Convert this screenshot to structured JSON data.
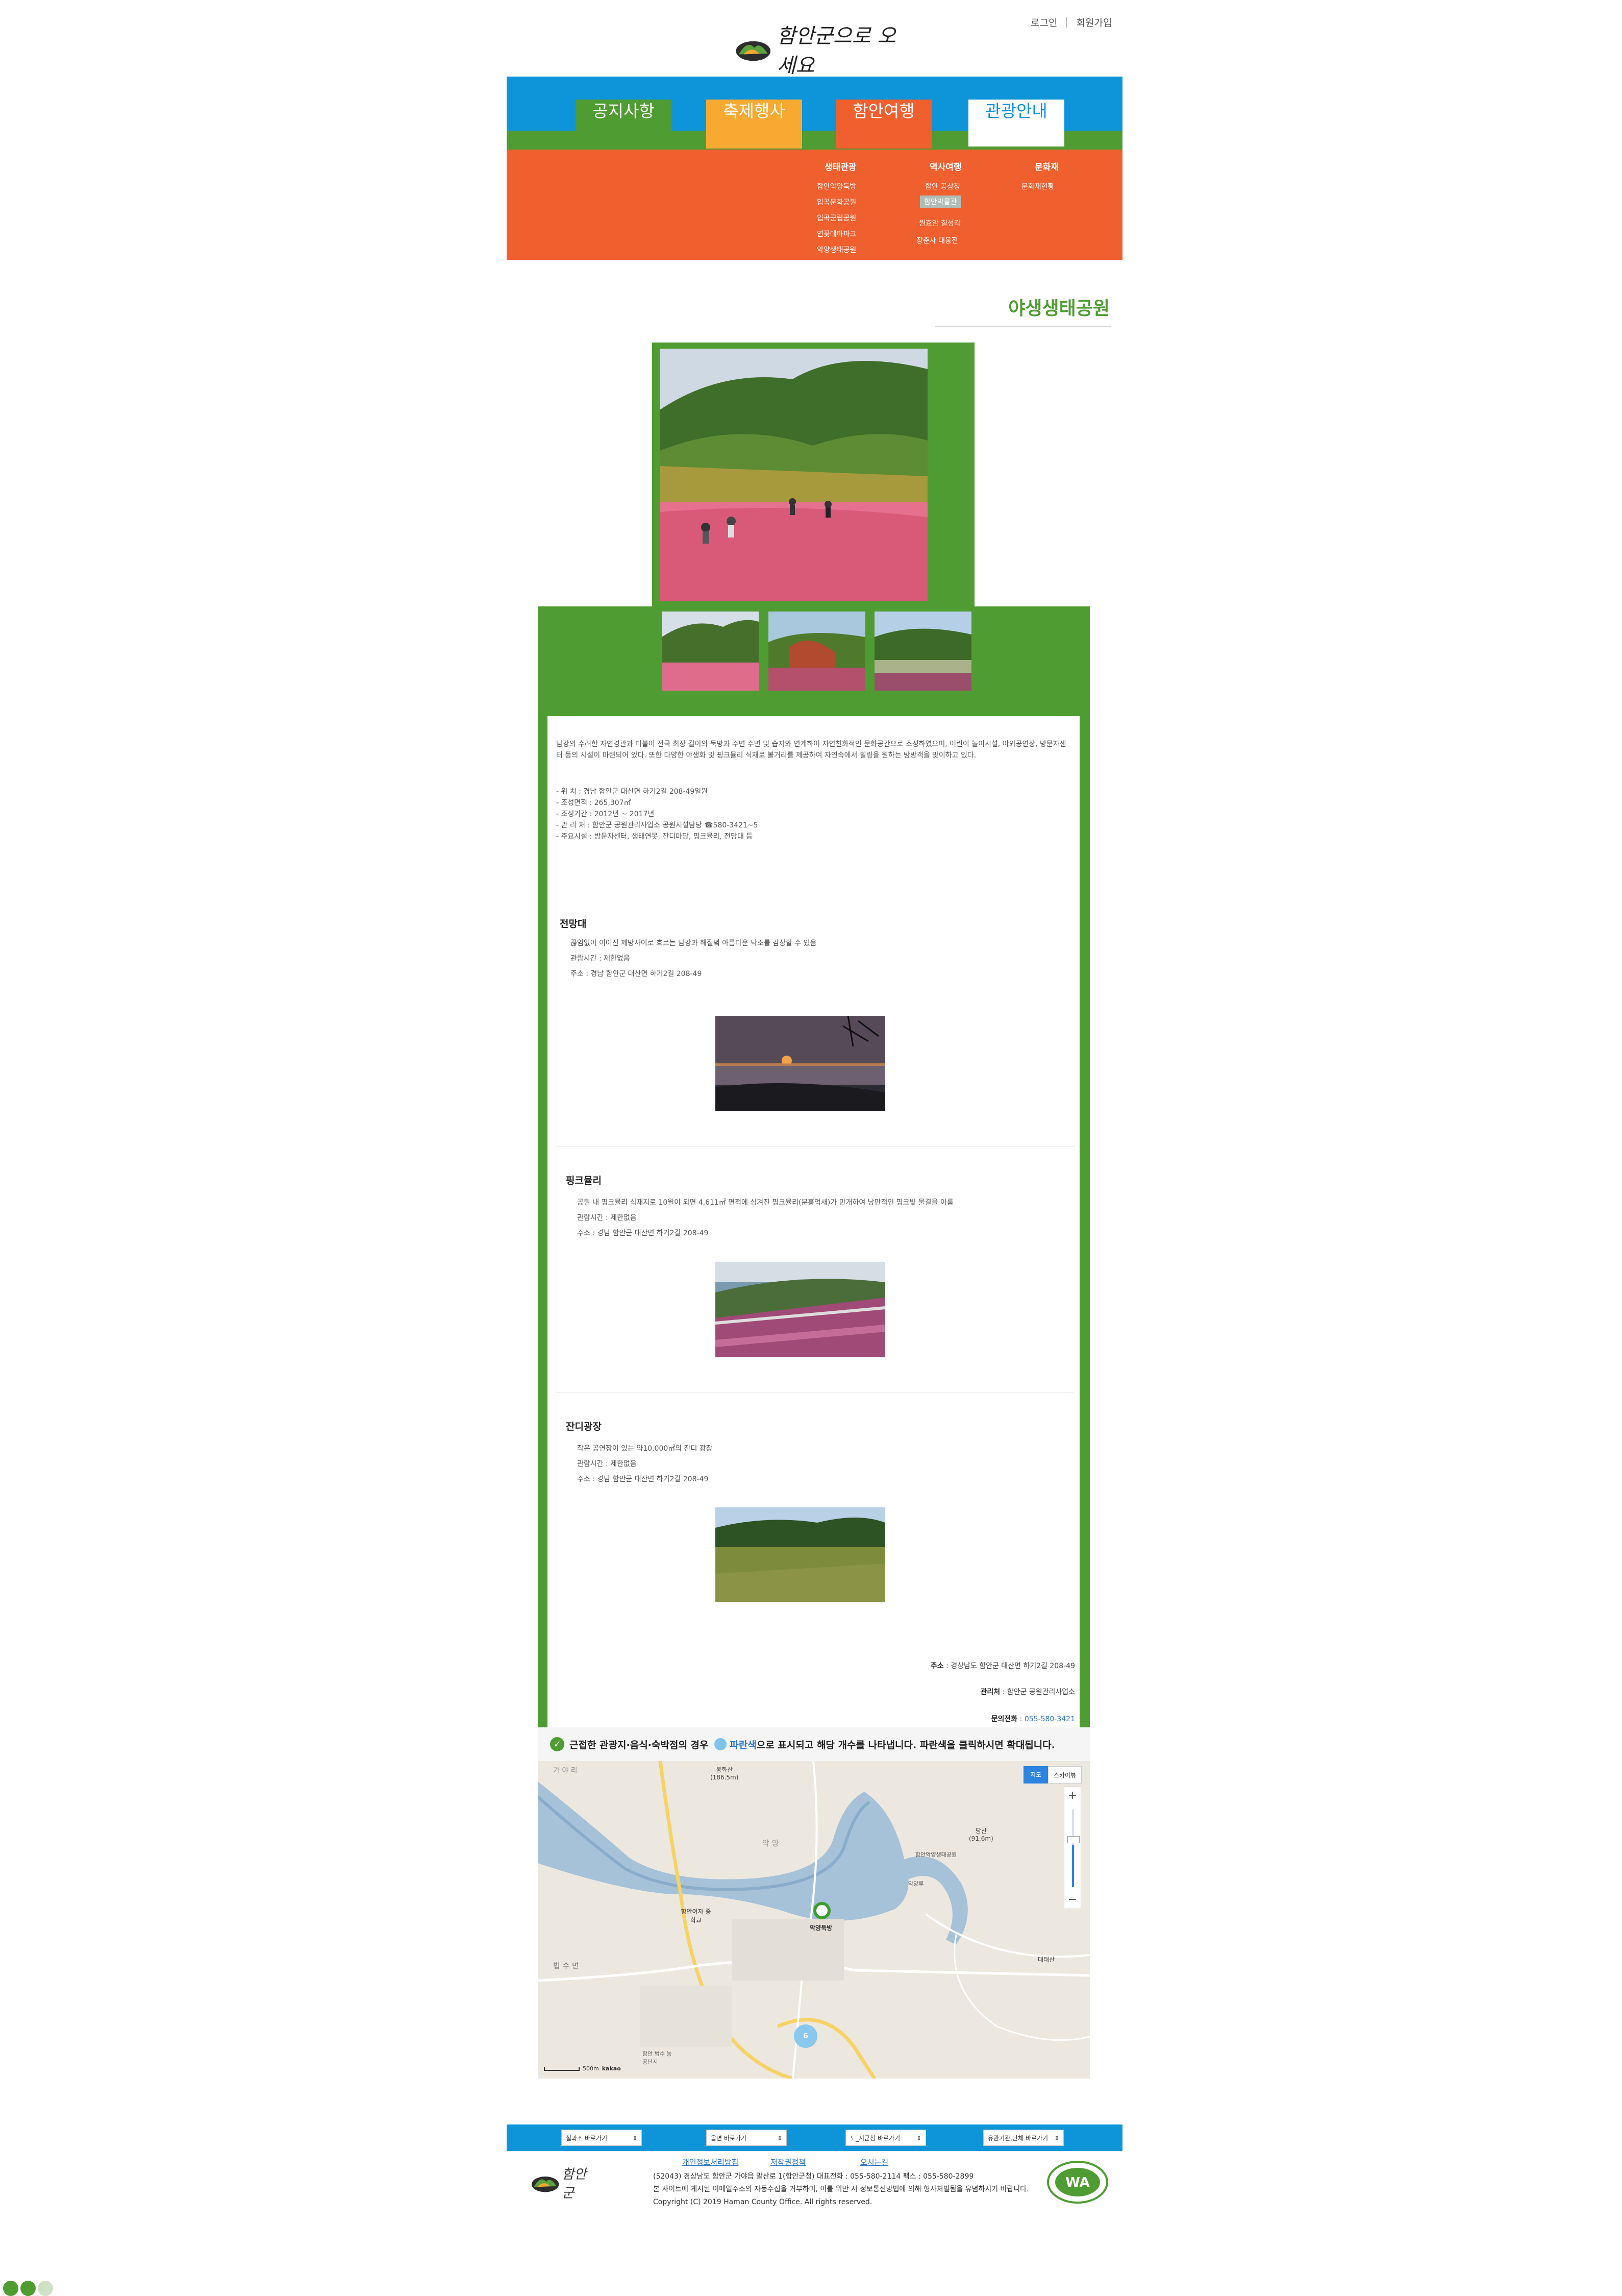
{
  "header": {
    "login": "로그인",
    "signup": "회원가입",
    "logo_text": "함안군으로 오세요"
  },
  "nav": {
    "tabs": [
      {
        "label": "공지사항",
        "color": "#4f9c33"
      },
      {
        "label": "축제행사",
        "color": "#f7a932"
      },
      {
        "label": "함안여행",
        "color": "#f05f2e"
      },
      {
        "label": "관광안내",
        "color": "#ffffff"
      }
    ],
    "submenu": {
      "col1": {
        "title": "생태관광",
        "items": [
          "함안악양둑방",
          "입곡문화공원",
          "입곡군립공원",
          "연꽃테마파크",
          "악양생태공원"
        ]
      },
      "col2": {
        "title": "역사여행",
        "items": [
          "함안 공상청",
          "함안박물관",
          "원효암 칠성각",
          "장춘사 대웅전"
        ]
      },
      "col3": {
        "title": "문화재",
        "items": [
          "문화재현황"
        ]
      }
    }
  },
  "page": {
    "title": "야생생태공원"
  },
  "intro": {
    "text": "남강의 수려한 자연경관과 더불어 전국 최장 길이의 둑방과 주변 수변 및 습지와 연계하여 자연친화적인 문화공간으로 조성하였으며, 어린이 놀이시설, 야외공연장, 방문자센터 등의 시설이 마련되어 있다. 또한 다양한 야생화 및 핑크뮬리 식재로 볼거리를 제공하여 자연속에서 힐링을 원하는 방방객을 맞이하고 있다.",
    "specs": [
      "- 위 치 : 경남 함안군 대산면 하기2길 208-49일원",
      "- 조성면적 : 265,307㎡",
      "- 조성기간 : 2012년 ~ 2017년",
      "- 관 리 처 : 함안군 공원관리사업소 공원시설담당 ☎580-3421~5",
      "- 주요시설 : 방문자센터, 생태연못, 잔디마당, 핑크뮬리, 전망대 등"
    ]
  },
  "sections": [
    {
      "title": "전망대",
      "lines": [
        "끊임없이 이어진 제방사이로 흐르는 남강과 해질녘 아름다운 낙조를 감상할 수 있음",
        "관람시간 : 제한없음",
        "주소 : 경남 함안군 대산면 하기2길 208-49"
      ]
    },
    {
      "title": "핑크뮬리",
      "lines": [
        "공원 내 핑크뮬리 식재지로 10월이 되면 4,611㎡ 면적에 심겨진 핑크뮬리(분홍억새)가 만개하여 낭만적인 핑크빛 물결을 이룸",
        "관람시간 : 제한없음",
        "주소 : 경남 함안군 대산면 하기2길 208-49"
      ]
    },
    {
      "title": "잔디광장",
      "lines": [
        "작은 공연장이 있는 약10,000㎡의 잔디 광장",
        "관람시간 : 제한없음",
        "주소 : 경남 함안군 대산면 하기2길 208-49"
      ]
    }
  ],
  "info": {
    "address_label": "주소",
    "address": "경상남도 함안군 대산면 하기2길 208-49",
    "manager_label": "관리처",
    "manager": "함안군 공원관리사업소",
    "phone_label": "문의전화",
    "phone": "055-580-3421"
  },
  "map": {
    "notice_a": "근접한 관광지·음식·숙박점의 경우",
    "notice_blue": "파란색",
    "notice_b": "으로 표시되고 해당 개수를 나타냅니다. 파란색을 클릭하시면 확대됩니다.",
    "btn_map": "지도",
    "btn_sky": "스카이뷰",
    "zoom_in": "+",
    "zoom_out": "−",
    "places": {
      "bongwhasan": "봉화산",
      "bongwhasan_h": "(186.5m)",
      "dangsan": "당산",
      "dangsan_h": "(91.6m)",
      "aksang": "악양둑방",
      "school": "함안여자 중학교",
      "beopsu": "법 수 면",
      "daetaesan": "대태산",
      "cluster": "6",
      "scale": "500m",
      "brand": "kakao",
      "label_1": "함안악양생태공원",
      "label_2": "악양루",
      "label_3": "악 양",
      "label_4": "함안 법수 농공단지",
      "label_5": "가 야 리"
    },
    "colors": {
      "river": "#a6c2d9",
      "road": "#f7d264",
      "land": "#ece8df"
    }
  },
  "footer": {
    "selects": [
      "실과소 바로가기",
      "읍면 바로가기",
      "도_시군청 바로가기",
      "유관기관,단체 바로가기"
    ],
    "links": [
      "개인정보처리방침",
      "저작권정책",
      "오시는길"
    ],
    "address_line": "(52043) 경상남도 함안군 가야읍 말산로 1(함안군청)    대표전화 : 055-580-2114    팩스 : 055-580-2899",
    "notice_line": "본 사이트에 게시된 이메일주소의 자동수집을 거부하며, 이를 위반 시 정보통신망법에 의해 형사처벌됨을 유념하시기 바랍니다.",
    "copyright": "Copyright (C) 2019 Haman County Office. All rights reserved.",
    "logo_text": "함안군",
    "badge_text": "WA"
  }
}
